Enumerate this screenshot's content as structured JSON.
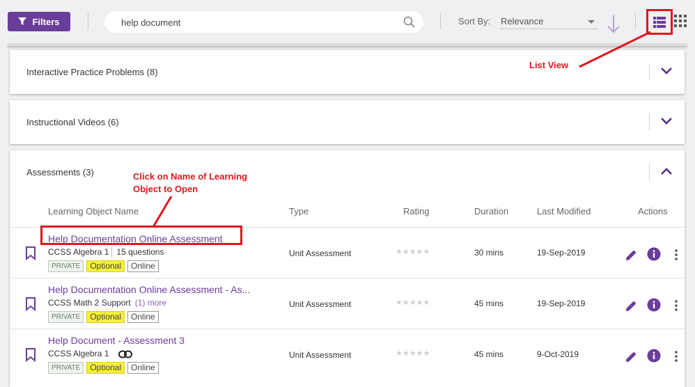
{
  "toolbar": {
    "filters_label": "Filters",
    "search_value": "help document",
    "sort_label": "Sort By:",
    "sort_value": "Relevance"
  },
  "sections": [
    {
      "title": "Interactive Practice Problems (8)"
    },
    {
      "title": "Instructional Videos (6)"
    },
    {
      "title": "Assessments (3)"
    }
  ],
  "table": {
    "headers": {
      "name": "Learning Object Name",
      "type": "Type",
      "rating": "Rating",
      "duration": "Duration",
      "modified": "Last Modified",
      "actions": "Actions"
    },
    "rows": [
      {
        "name": "Help Documentation Online Assessment",
        "course": "CCSS Algebra 1",
        "extra": "15 questions",
        "tags": [
          "PRIVATE",
          "Optional",
          "Online"
        ],
        "type": "Unit Assessment",
        "stars": "★★★★★",
        "duration": "30 mins",
        "modified": "19-Sep-2019"
      },
      {
        "name": "Help Documentation Online Assessment - As...",
        "course": "CCSS Math 2 Support",
        "extra": "(1) more",
        "tags": [
          "PRIVATE",
          "Optional",
          "Online"
        ],
        "type": "Unit Assessment",
        "stars": "★★★★★",
        "duration": "45 mins",
        "modified": "19-Sep-2019"
      },
      {
        "name": "Help Document - Assessment 3",
        "course": "CCSS Algebra 1",
        "extra": "",
        "tags": [
          "PRIVATE",
          "Optional",
          "Online"
        ],
        "type": "Unit Assessment",
        "stars": "★★★★★",
        "duration": "45 mins",
        "modified": "9-Oct-2019"
      }
    ]
  },
  "annotations": {
    "list_view": "List View",
    "click_name_line1": "Click on Name of Learning",
    "click_name_line2": "Object to Open"
  },
  "colors": {
    "accent": "#6a3d9a",
    "annotation": "#e0161e",
    "optional_tag": "#f7f039"
  },
  "icons": [
    "filter-icon",
    "search-icon",
    "arrow-down-icon",
    "list-view-icon",
    "grid-view-icon",
    "chevron-down-icon",
    "chevron-up-icon",
    "bookmark-icon",
    "link-icon",
    "pencil-icon",
    "info-icon",
    "more-vertical-icon"
  ]
}
